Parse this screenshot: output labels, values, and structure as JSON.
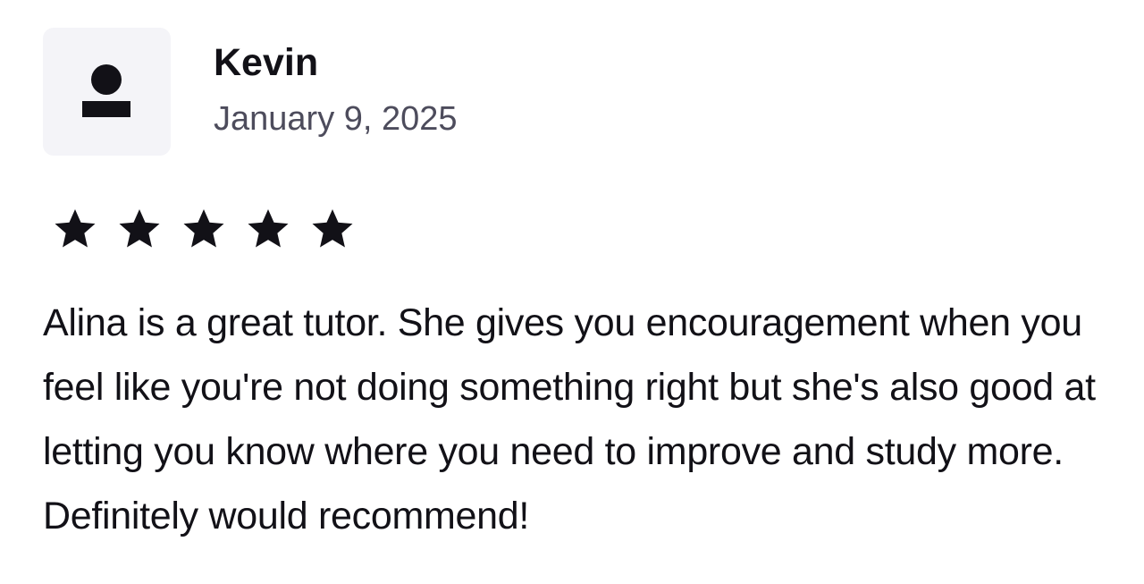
{
  "review": {
    "author": {
      "name": "Kevin",
      "avatar_icon": "user-placeholder-icon"
    },
    "date": "January 9, 2025",
    "rating": {
      "value": 5,
      "max": 5,
      "star_icon": "star-icon"
    },
    "text": "Alina is a great tutor. She gives you encouragement when you feel like you're not doing something right but she's also good at letting you know where you need to improve and study more. Definitely would recommend!"
  },
  "colors": {
    "text": "#121117",
    "muted_text": "#4d4c5c",
    "avatar_bg": "#f4f4f8",
    "star": "#121117"
  }
}
